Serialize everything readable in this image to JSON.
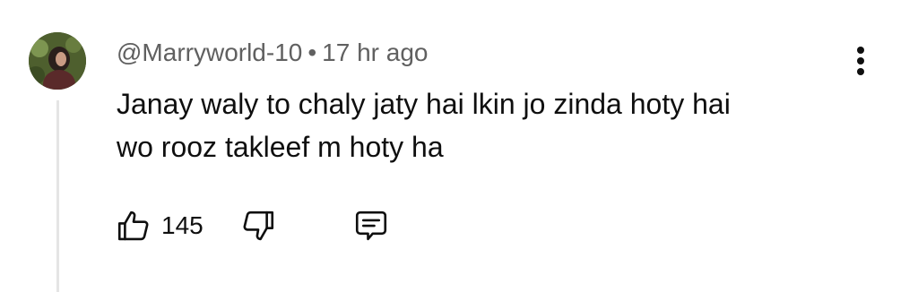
{
  "comment": {
    "author": "@Marryworld-10",
    "separator": "•",
    "timestamp": "17 hr ago",
    "text_lines": [
      "Janay waly to chaly jaty hai lkin jo zinda hoty hai",
      "wo rooz takleef m hoty ha"
    ],
    "like_count": "145"
  },
  "icons": {
    "like": "thumbs-up-icon",
    "dislike": "thumbs-down-icon",
    "reply": "comment-icon",
    "menu": "more-vert-icon"
  },
  "colors": {
    "text_primary": "#0f0f0f",
    "text_secondary": "#606060",
    "thread_line": "#e5e5e5"
  }
}
